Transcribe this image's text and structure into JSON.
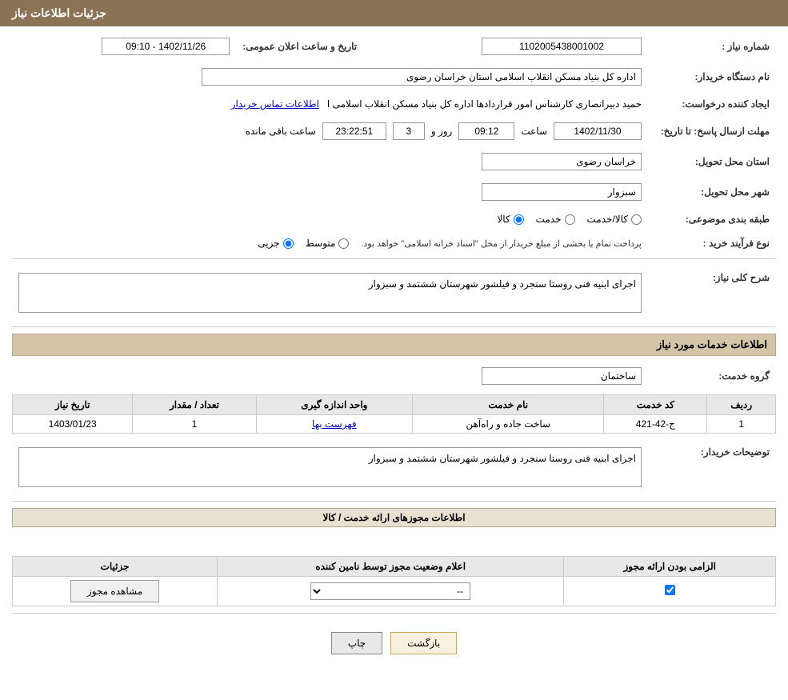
{
  "header": {
    "title": "جزئیات اطلاعات نیاز"
  },
  "fields": {
    "need_number_label": "شماره نیاز :",
    "need_number_value": "1102005438001002",
    "announce_datetime_label": "تاریخ و ساعت اعلان عمومی:",
    "announce_datetime_value": "1402/11/26 - 09:10",
    "buyer_org_label": "نام دستگاه خریدار:",
    "buyer_org_value": "اداره کل بنیاد مسکن انقلاب اسلامی استان خراسان رضوی",
    "requester_label": "ایجاد کننده درخواست:",
    "requester_value": "حمید دبیرانصاری کارشناس امور قراردادها اداره کل بنیاد مسکن انقلاب اسلامی ا",
    "contact_link": "اطلاعات تماس خریدار",
    "response_deadline_label": "مهلت ارسال پاسخ: تا تاریخ:",
    "response_date": "1402/11/30",
    "response_time_label": "ساعت",
    "response_time": "09:12",
    "response_day_label": "روز و",
    "response_days": "3",
    "response_remaining_label": "ساعت باقی مانده",
    "response_remaining": "23:22:51",
    "province_label": "استان محل تحویل:",
    "province_value": "خراسان رضوی",
    "city_label": "شهر محل تحویل:",
    "city_value": "سبزوار",
    "category_label": "طبقه بندی موضوعی:",
    "category_option1": "کالا",
    "category_option2": "خدمت",
    "category_option3": "کالا/خدمت",
    "process_label": "نوع فرآیند خرید :",
    "process_option1": "جزیی",
    "process_option2": "متوسط",
    "process_note": "پرداخت تمام یا بخشی از مبلغ خریدار از محل \"اسناد خزانه اسلامی\" خواهد بود.",
    "description_label": "شرح کلی نیاز:",
    "description_value": "اجرای ابنیه فنی روستا سنجرد و فیلشور شهرستان ششتمد و سبزوار",
    "services_section_title": "اطلاعات خدمات مورد نیاز",
    "service_group_label": "گروه خدمت:",
    "service_group_value": "ساختمان",
    "table_col1": "ردیف",
    "table_col2": "کد خدمت",
    "table_col3": "نام خدمت",
    "table_col4": "واحد اندازه گیری",
    "table_col5": "تعداد / مقدار",
    "table_col6": "تاریخ نیاز",
    "table_row1": {
      "row": "1",
      "code": "ج-42-421",
      "name": "ساخت جاده و راه‌آهن",
      "unit": "فهرست بها",
      "quantity": "1",
      "date": "1403/01/23"
    },
    "buyer_desc_label": "توضیحات خریدار:",
    "buyer_desc_value": "اجرای ابنیه فنی روستا سنجرد و فیلشور شهرستان ششتمد و سبزوار",
    "permission_section_title": "اطلاعات مجوزهای ارائه خدمت / کالا",
    "perm_col1": "الزامی بودن ارائه مجوز",
    "perm_col2": "اعلام وضعیت مجوز توسط نامین کننده",
    "perm_col3": "جزئیات",
    "perm_row1": {
      "required": "☑",
      "status": "--",
      "details": "مشاهده مجوز"
    },
    "btn_print": "چاپ",
    "btn_back": "بازگشت"
  }
}
